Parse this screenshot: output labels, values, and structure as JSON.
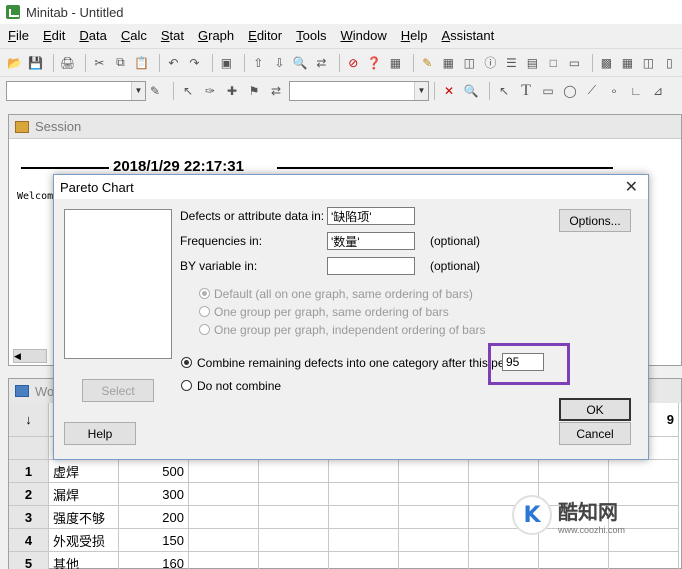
{
  "app": {
    "title": "Minitab - Untitled",
    "menu": [
      "File",
      "Edit",
      "Data",
      "Calc",
      "Stat",
      "Graph",
      "Editor",
      "Tools",
      "Window",
      "Help",
      "Assistant"
    ]
  },
  "session": {
    "title": "Session",
    "timestamp": "2018/1/29 22:17:31",
    "welcome": "Welcome"
  },
  "worksheet": {
    "title": "Wo",
    "header_symbol": "↓",
    "col_visible": "9",
    "rows": [
      {
        "n": "1",
        "c1": "虚焊",
        "c2": "500"
      },
      {
        "n": "2",
        "c1": "漏焊",
        "c2": "300"
      },
      {
        "n": "3",
        "c1": "强度不够",
        "c2": "200"
      },
      {
        "n": "4",
        "c1": "外观受损",
        "c2": "150"
      },
      {
        "n": "5",
        "c1": "其他",
        "c2": "160"
      }
    ]
  },
  "dialog": {
    "title": "Pareto Chart",
    "defects_label": "Defects or attribute data in:",
    "defects_value": "'缺陷项'",
    "frequencies_label": "Frequencies in:",
    "frequencies_value": "'数量'",
    "frequencies_hint": "(optional)",
    "byvar_label": "BY variable in:",
    "byvar_value": "",
    "byvar_hint": "(optional)",
    "option_default": "Default (all on one graph, same ordering of bars)",
    "option_one_group_same": "One group per graph, same ordering of bars",
    "option_one_group_indep": "One group per graph, independent ordering of bars",
    "combine_label": "Combine remaining defects into one category after this percent",
    "combine_value": "95",
    "not_combine_label": "Do not combine",
    "select_button": "Select",
    "help_button": "Help",
    "options_button": "Options...",
    "ok_button": "OK",
    "cancel_button": "Cancel"
  },
  "watermark": {
    "brand": "酷知网",
    "url": "www.coozhi.com",
    "logo_letter": "K"
  },
  "colors": {
    "highlight": "#7d3fb5",
    "logo_blue": "#2b78d4"
  }
}
